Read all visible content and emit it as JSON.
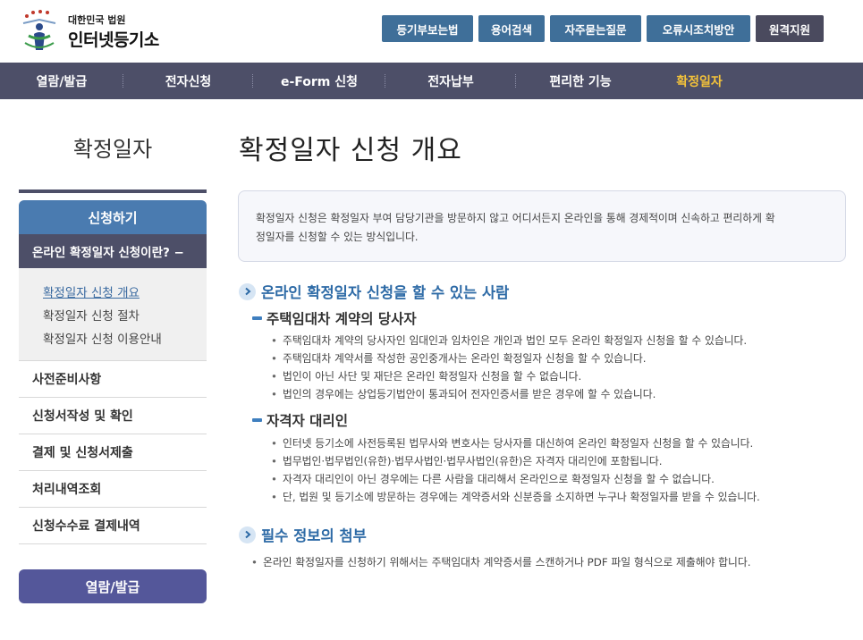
{
  "header": {
    "logo_small": "대한민국 법원",
    "logo_big": "인터넷등기소",
    "top_buttons": [
      "등기부보는법",
      "용어검색",
      "자주묻는질문",
      "오류시조치방안",
      "원격지원"
    ]
  },
  "gnb": {
    "items": [
      "열람/발급",
      "전자신청",
      "e-Form 신청",
      "전자납부",
      "편리한 기능",
      "확정일자"
    ],
    "active": "확정일자"
  },
  "sidebar": {
    "title": "확정일자",
    "apply": "신청하기",
    "online": "온라인 확정일자 신청이란?  −",
    "sub_items": [
      "확정일자 신청 개요",
      "확정일자 신청 절차",
      "확정일자 신청 이용안내"
    ],
    "menu_items": [
      "사전준비사항",
      "신청서작성 및 확인",
      "결제 및 신청서제출",
      "처리내역조회",
      "신청수수료 결제내역"
    ],
    "view_button": "열람/발급"
  },
  "main": {
    "title": "확정일자 신청 개요",
    "intro_line1": "확정일자 신청은 확정일자 부여 담당기관을 방문하지 않고 어디서든지 온라인을 통해 경제적이며 신속하고 편리하게 확",
    "intro_line2": "정일자를 신청할 수 있는 방식입니다.",
    "section1": {
      "title": "온라인 확정일자 신청을 할 수 있는 사람",
      "sub1": {
        "title": "주택임대차 계약의 당사자",
        "bullets": [
          "주택임대차 계약의 당사자인 임대인과 임차인은 개인과 법인 모두 온라인 확정일자 신청을 할 수 있습니다.",
          "주택임대차 계약서를 작성한 공인중개사는 온라인 확정일자 신청을 할 수 있습니다.",
          "법인이 아닌 사단 및 재단은 온라인 확정일자 신청을 할 수 없습니다.",
          "법인의 경우에는 상업등기법안이 통과되어 전자인증서를 받은 경우에 할 수 있습니다."
        ]
      },
      "sub2": {
        "title": "자격자 대리인",
        "bullets": [
          "인터넷 등기소에 사전등록된 법무사와 변호사는 당사자를 대신하여 온라인 확정일자 신청을 할 수 있습니다.",
          "법무법인·법무법인(유한)·법무사법인·법무사법인(유한)은 자격자 대리인에 포함됩니다.",
          "자격자 대리인이 아닌 경우에는 다른 사람을 대리해서 온라인으로 확정일자 신청을 할 수 없습니다.",
          "단, 법원 및 등기소에 방문하는 경우에는 계약증서와 신분증을 소지하면 누구나 확정일자를 받을 수 있습니다."
        ]
      }
    },
    "section2": {
      "title": "필수 정보의 첨부",
      "bullets": [
        "온라인 확정일자를 신청하기 위해서는 주택임대차 계약증서를 스캔하거나 PDF 파일 형식으로 제출해야 합니다."
      ]
    }
  },
  "colors": {
    "gnb_bg": "#4d4f68",
    "gnb_active": "#f4c33a",
    "top_button": "#3f6f99",
    "side_apply": "#4a7bb0",
    "side_view": "#54579a",
    "section_title": "#2d6aa6"
  }
}
